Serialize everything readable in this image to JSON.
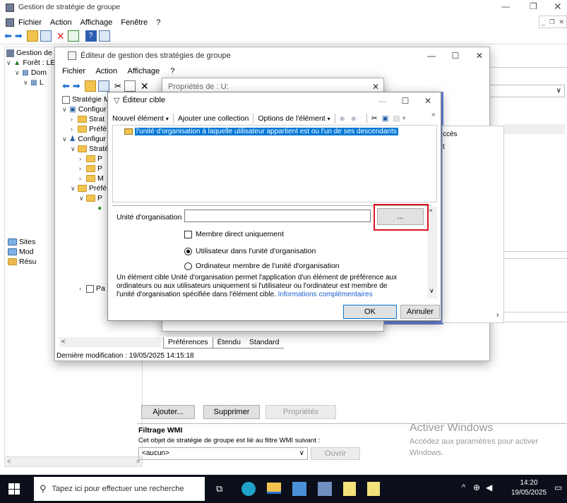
{
  "app_title": "Gestion de stratégie de groupe",
  "main_menu": [
    "Fichier",
    "Action",
    "Affichage",
    "Fenêtre",
    "?"
  ],
  "left_tree": {
    "root": "Gestion de s",
    "forest": "Forêt : LE",
    "domains": "Dom",
    "sites": "Sites",
    "modeling": "Mod",
    "results": "Résu"
  },
  "editor": {
    "title": "Éditeur de gestion des stratégies de groupe",
    "menu": [
      "Fichier",
      "Action",
      "Affichage",
      "?"
    ],
    "tree": {
      "policy": "Stratégie Mo",
      "computer_config": "Configur",
      "strat1": "Strat",
      "pref1": "Préfé",
      "user_config": "Configur",
      "strat2": "Straté",
      "p1": "P",
      "p2": "P",
      "m": "M",
      "pref2": "Préfé",
      "p3": "P",
      "pa": "Pa"
    }
  },
  "props_window": {
    "title": "Propriétés de : U:",
    "right_col": [
      "ccès",
      "t"
    ],
    "tabs": [
      "Préférences",
      "Étendu",
      "Standard"
    ],
    "last_modified": "Dernière modification : 19/05/2025 14:15:18"
  },
  "target_editor": {
    "title": "Éditeur cible",
    "toolbar": {
      "new_item": "Nouvel élément",
      "add_collection": "Ajouter une collection",
      "item_options": "Options de l'élément",
      "more": "»"
    },
    "list_item": "l'unité d'organisation à laquelle utilisateur appartient est  ou l'un de ses descendants",
    "ou_label": "Unité d'organisation",
    "ou_value": "",
    "browse_label": "...",
    "direct_member": "Membre direct uniquement",
    "radio_user": "Utilisateur dans l'unité d'organisation",
    "radio_computer": "Ordinateur membre de l'unité d'organisation",
    "description": "Un élément cible Unité d'organisation permet l'application d'un élément de préférence aux ordinateurs ou aux utilisateurs uniquement si l'utilisateur ou l'ordinateur est membre de l'unité d'organisation spécifiée dans l'élément cible.",
    "more_info": "Informations complémentaires",
    "ok": "OK",
    "cancel": "Annuler"
  },
  "lower_panel": {
    "add": "Ajouter...",
    "remove": "Supprimer",
    "properties": "Propriétés",
    "wmi_title": "Filtrage WMI",
    "wmi_text": "Cet objet de stratégie de groupe est lié au filtre WMI suivant :",
    "wmi_select": "<aucun>",
    "open": "Ouvrir"
  },
  "watermark": {
    "line1": "Activer Windows",
    "line2": "Accédez aux paramètres pour activer",
    "line3": "Windows."
  },
  "taskbar": {
    "search_placeholder": "Tapez ici pour effectuer une recherche",
    "time": "14:20",
    "date": "19/05/2025"
  },
  "colors": {
    "selection": "#0078d7",
    "highlight_border": "#e0141e",
    "taskbar": "#0b0f1a",
    "blue_panel": "#6b86d9"
  }
}
